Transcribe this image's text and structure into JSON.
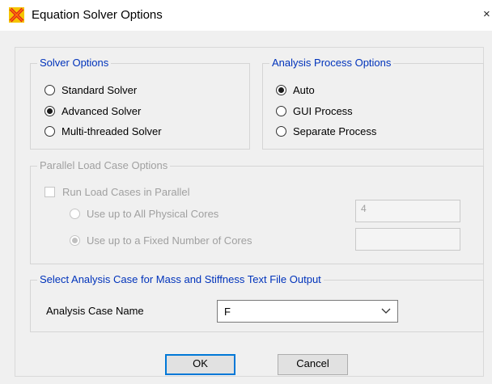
{
  "window": {
    "title": "Equation Solver Options",
    "close_glyph": "×"
  },
  "solver_options": {
    "legend": "Solver Options",
    "items": [
      {
        "label": "Standard Solver",
        "checked": false
      },
      {
        "label": "Advanced Solver",
        "checked": true
      },
      {
        "label": "Multi-threaded Solver",
        "checked": false
      }
    ]
  },
  "analysis_process": {
    "legend": "Analysis Process Options",
    "items": [
      {
        "label": "Auto",
        "checked": true
      },
      {
        "label": "GUI Process",
        "checked": false
      },
      {
        "label": "Separate Process",
        "checked": false
      }
    ]
  },
  "parallel": {
    "legend": "Parallel Load Case Options",
    "run_label": "Run Load Cases in Parallel",
    "use_physical_label": "Use up to All Physical Cores",
    "physical_cores_value": "4",
    "use_fixed_label": "Use up to a Fixed Number of Cores",
    "fixed_cores_value": ""
  },
  "output": {
    "legend": "Select Analysis Case for Mass and Stiffness Text File Output",
    "case_label": "Analysis Case Name",
    "case_value": "F"
  },
  "buttons": {
    "ok": "OK",
    "cancel": "Cancel"
  },
  "colors": {
    "legend_blue": "#0033bb",
    "disabled_text": "#a0a0a0",
    "focus_border": "#0078d7"
  },
  "icons": {
    "app": "sap2000-logo-icon",
    "close": "close-icon",
    "dropdown": "chevron-down-icon"
  }
}
